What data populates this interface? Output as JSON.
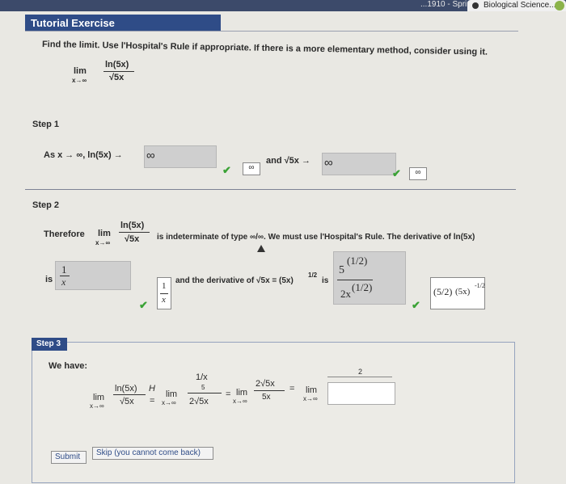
{
  "browser": {
    "tab_left": "...1910 - Sprin...",
    "tab_right": "Biological Science..."
  },
  "header": {
    "title": "Tutorial Exercise"
  },
  "problem": {
    "instruction": "Find the limit. Use l'Hospital's Rule if appropriate. If there is a more elementary method, consider using it.",
    "lim": "lim",
    "lim_sub": "x→∞",
    "numerator": "ln(5x)",
    "denominator": "√5x"
  },
  "step1": {
    "title": "Step 1",
    "as_text": "As x → ∞, ln(5x) →",
    "answer1": "∞",
    "mini1": "∞",
    "and_text": "and √5x →",
    "answer2": "∞",
    "mini2": "∞"
  },
  "step2": {
    "title": "Step 2",
    "therefore": "Therefore",
    "lim": "lim",
    "lim_sub": "x→∞",
    "num": "ln(5x)",
    "den": "√5x",
    "indet_text": "is indeterminate of type ∞/∞. We must use l'Hospital's Rule. The derivative of ln(5x)",
    "is_label": "is",
    "answer_num": "1",
    "answer_den": "x",
    "mini_num": "1",
    "mini_den": "x",
    "deriv_text": "and the derivative of √5x = (5x)",
    "exponent": "1/2",
    "is2": "is",
    "answer2_coef": "5",
    "answer2_top_frac": "(1/2)",
    "answer2_den": "2x",
    "answer2_den_frac": "(1/2)",
    "mini2_main": "(5/2)",
    "mini2_rest": "(5x)",
    "mini2_exp": "-1/2"
  },
  "step3": {
    "tab": "Step 3",
    "we_have": "We have:",
    "lim": "lim",
    "lim_sub": "x→∞",
    "num1": "ln(5x)",
    "den1": "√5x",
    "h_label": "H",
    "eq": "=",
    "num2_top": "1/x",
    "num2_mid": "5",
    "den2": "2√5x",
    "num3": "2√5x",
    "den3": "5x",
    "box_value": "2",
    "submit": "Submit",
    "skip": "Skip (you cannot come back)"
  }
}
